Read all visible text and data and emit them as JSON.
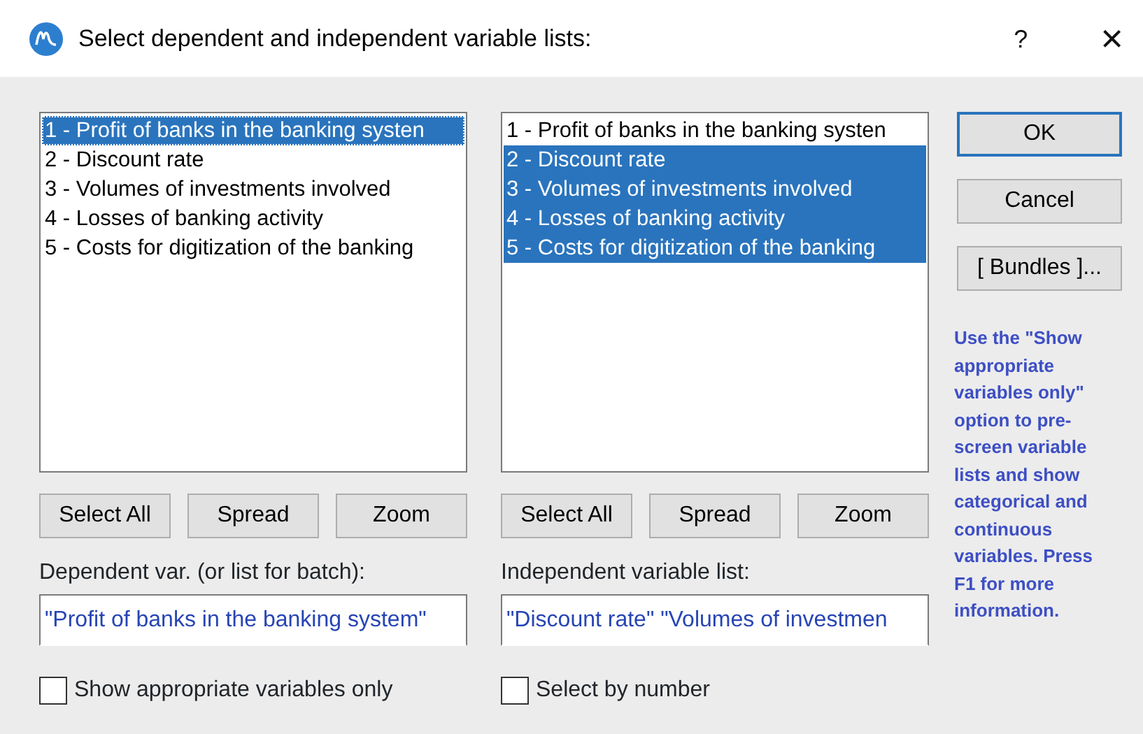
{
  "window": {
    "title": "Select dependent and independent variable lists:",
    "help": "?",
    "close": "×"
  },
  "panes": [
    {
      "items": [
        {
          "label": "1 - Profit of banks in the banking systen",
          "selected": true
        },
        {
          "label": "2 - Discount rate",
          "selected": false
        },
        {
          "label": "3 - Volumes of investments involved",
          "selected": false
        },
        {
          "label": "4 - Losses of banking activity",
          "selected": false
        },
        {
          "label": "5 - Costs for digitization of the banking",
          "selected": false
        }
      ],
      "buttons": [
        "Select All",
        "Spread",
        "Zoom"
      ],
      "field_label": "Dependent var. (or list for batch):",
      "field_value": "\"Profit of banks in the banking system\"",
      "option": {
        "label": "Show appropriate variables only",
        "checked": false
      }
    },
    {
      "items": [
        {
          "label": "1 - Profit of banks in the banking systen",
          "selected": false
        },
        {
          "label": "2 - Discount rate",
          "selected": true
        },
        {
          "label": "3 - Volumes of investments involved",
          "selected": true
        },
        {
          "label": "4 - Losses of banking activity",
          "selected": true
        },
        {
          "label": "5 - Costs for digitization of the banking",
          "selected": true
        }
      ],
      "buttons": [
        "Select All",
        "Spread",
        "Zoom"
      ],
      "field_label": "Independent variable list:",
      "field_value": "\"Discount rate\" \"Volumes of investmen",
      "option": {
        "label": "Select by number",
        "checked": false
      }
    }
  ],
  "side_buttons": [
    {
      "label": "OK",
      "default": true
    },
    {
      "label": "Cancel",
      "default": false
    },
    {
      "label": "[ Bundles ]...",
      "default": false
    }
  ],
  "hint": "Use the \"Show appropriate variables only\" option to pre-screen variable lists and show categorical and continuous variables. Press F1 for more information."
}
